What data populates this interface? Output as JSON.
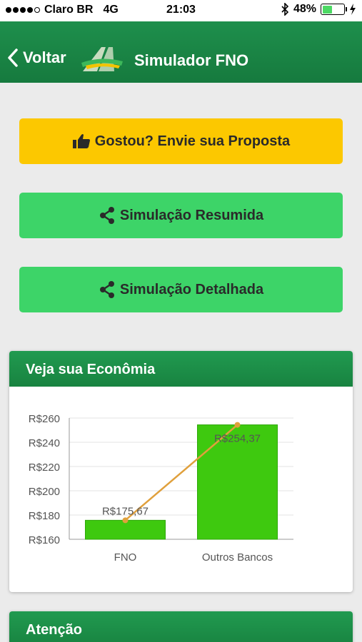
{
  "statusbar": {
    "carrier": "Claro BR",
    "network": "4G",
    "time": "21:03",
    "battery": "48%",
    "battery_level": 0.48
  },
  "nav": {
    "back_label": "Voltar",
    "title": "Simulador FNO",
    "logo_icon": "fno-logo-icon"
  },
  "buttons": {
    "proposta": "Gostou? Envie sua Proposta",
    "resumida": "Simulação Resumida",
    "detalhada": "Simulação Detalhada"
  },
  "economia": {
    "title": "Veja sua Econômia"
  },
  "atencao": {
    "title": "Atenção"
  },
  "colors": {
    "green_header": "#1e8f4c",
    "yellow": "#fcc800",
    "green_button": "#3dd468",
    "bar": "#3ec90f",
    "line": "#e0a03c"
  },
  "chart_data": {
    "type": "bar",
    "categories": [
      "FNO",
      "Outros Bancos"
    ],
    "values": [
      175.67,
      254.37
    ],
    "data_labels": [
      "R$175,67",
      "R$254,37"
    ],
    "y_ticks": [
      "R$160",
      "R$180",
      "R$200",
      "R$220",
      "R$240",
      "R$260"
    ],
    "ylim": [
      160,
      260
    ],
    "overlay": "line",
    "grid": true
  }
}
